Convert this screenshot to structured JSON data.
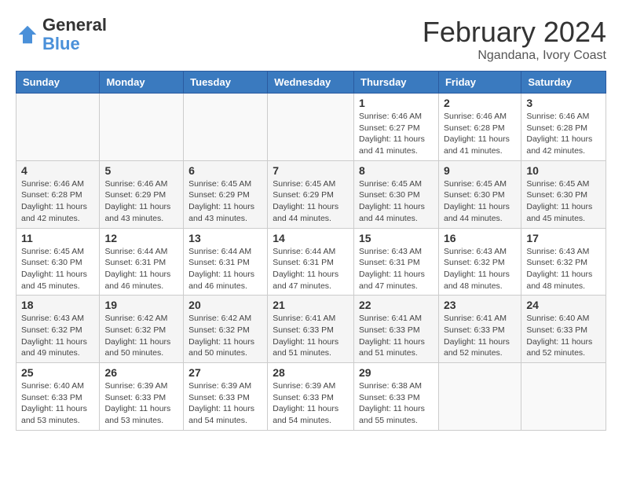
{
  "header": {
    "logo_line1": "General",
    "logo_line2": "Blue",
    "title": "February 2024",
    "subtitle": "Ngandana, Ivory Coast"
  },
  "columns": [
    "Sunday",
    "Monday",
    "Tuesday",
    "Wednesday",
    "Thursday",
    "Friday",
    "Saturday"
  ],
  "weeks": [
    [
      {
        "day": "",
        "info": ""
      },
      {
        "day": "",
        "info": ""
      },
      {
        "day": "",
        "info": ""
      },
      {
        "day": "",
        "info": ""
      },
      {
        "day": "1",
        "info": "Sunrise: 6:46 AM\nSunset: 6:27 PM\nDaylight: 11 hours\nand 41 minutes."
      },
      {
        "day": "2",
        "info": "Sunrise: 6:46 AM\nSunset: 6:28 PM\nDaylight: 11 hours\nand 41 minutes."
      },
      {
        "day": "3",
        "info": "Sunrise: 6:46 AM\nSunset: 6:28 PM\nDaylight: 11 hours\nand 42 minutes."
      }
    ],
    [
      {
        "day": "4",
        "info": "Sunrise: 6:46 AM\nSunset: 6:28 PM\nDaylight: 11 hours\nand 42 minutes."
      },
      {
        "day": "5",
        "info": "Sunrise: 6:46 AM\nSunset: 6:29 PM\nDaylight: 11 hours\nand 43 minutes."
      },
      {
        "day": "6",
        "info": "Sunrise: 6:45 AM\nSunset: 6:29 PM\nDaylight: 11 hours\nand 43 minutes."
      },
      {
        "day": "7",
        "info": "Sunrise: 6:45 AM\nSunset: 6:29 PM\nDaylight: 11 hours\nand 44 minutes."
      },
      {
        "day": "8",
        "info": "Sunrise: 6:45 AM\nSunset: 6:30 PM\nDaylight: 11 hours\nand 44 minutes."
      },
      {
        "day": "9",
        "info": "Sunrise: 6:45 AM\nSunset: 6:30 PM\nDaylight: 11 hours\nand 44 minutes."
      },
      {
        "day": "10",
        "info": "Sunrise: 6:45 AM\nSunset: 6:30 PM\nDaylight: 11 hours\nand 45 minutes."
      }
    ],
    [
      {
        "day": "11",
        "info": "Sunrise: 6:45 AM\nSunset: 6:30 PM\nDaylight: 11 hours\nand 45 minutes."
      },
      {
        "day": "12",
        "info": "Sunrise: 6:44 AM\nSunset: 6:31 PM\nDaylight: 11 hours\nand 46 minutes."
      },
      {
        "day": "13",
        "info": "Sunrise: 6:44 AM\nSunset: 6:31 PM\nDaylight: 11 hours\nand 46 minutes."
      },
      {
        "day": "14",
        "info": "Sunrise: 6:44 AM\nSunset: 6:31 PM\nDaylight: 11 hours\nand 47 minutes."
      },
      {
        "day": "15",
        "info": "Sunrise: 6:43 AM\nSunset: 6:31 PM\nDaylight: 11 hours\nand 47 minutes."
      },
      {
        "day": "16",
        "info": "Sunrise: 6:43 AM\nSunset: 6:32 PM\nDaylight: 11 hours\nand 48 minutes."
      },
      {
        "day": "17",
        "info": "Sunrise: 6:43 AM\nSunset: 6:32 PM\nDaylight: 11 hours\nand 48 minutes."
      }
    ],
    [
      {
        "day": "18",
        "info": "Sunrise: 6:43 AM\nSunset: 6:32 PM\nDaylight: 11 hours\nand 49 minutes."
      },
      {
        "day": "19",
        "info": "Sunrise: 6:42 AM\nSunset: 6:32 PM\nDaylight: 11 hours\nand 50 minutes."
      },
      {
        "day": "20",
        "info": "Sunrise: 6:42 AM\nSunset: 6:32 PM\nDaylight: 11 hours\nand 50 minutes."
      },
      {
        "day": "21",
        "info": "Sunrise: 6:41 AM\nSunset: 6:33 PM\nDaylight: 11 hours\nand 51 minutes."
      },
      {
        "day": "22",
        "info": "Sunrise: 6:41 AM\nSunset: 6:33 PM\nDaylight: 11 hours\nand 51 minutes."
      },
      {
        "day": "23",
        "info": "Sunrise: 6:41 AM\nSunset: 6:33 PM\nDaylight: 11 hours\nand 52 minutes."
      },
      {
        "day": "24",
        "info": "Sunrise: 6:40 AM\nSunset: 6:33 PM\nDaylight: 11 hours\nand 52 minutes."
      }
    ],
    [
      {
        "day": "25",
        "info": "Sunrise: 6:40 AM\nSunset: 6:33 PM\nDaylight: 11 hours\nand 53 minutes."
      },
      {
        "day": "26",
        "info": "Sunrise: 6:39 AM\nSunset: 6:33 PM\nDaylight: 11 hours\nand 53 minutes."
      },
      {
        "day": "27",
        "info": "Sunrise: 6:39 AM\nSunset: 6:33 PM\nDaylight: 11 hours\nand 54 minutes."
      },
      {
        "day": "28",
        "info": "Sunrise: 6:39 AM\nSunset: 6:33 PM\nDaylight: 11 hours\nand 54 minutes."
      },
      {
        "day": "29",
        "info": "Sunrise: 6:38 AM\nSunset: 6:33 PM\nDaylight: 11 hours\nand 55 minutes."
      },
      {
        "day": "",
        "info": ""
      },
      {
        "day": "",
        "info": ""
      }
    ]
  ]
}
